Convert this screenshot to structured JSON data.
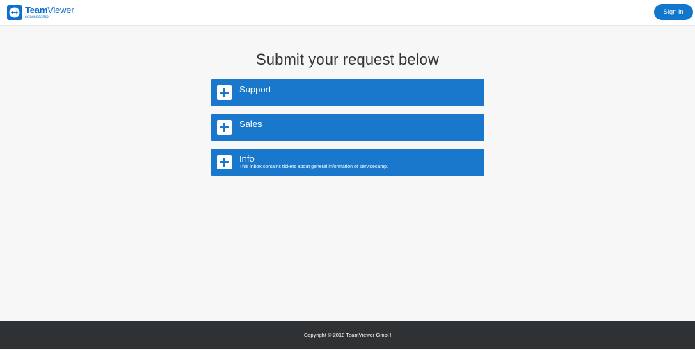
{
  "header": {
    "logo": {
      "brand_bold": "Team",
      "brand_light": "Viewer",
      "subtitle": "servicecamp",
      "icon": "teamviewer-logo-icon"
    },
    "sign_in_label": "Sign in"
  },
  "main": {
    "title": "Submit your request below",
    "inboxes": [
      {
        "name": "Support",
        "description": "",
        "icon": "plus-icon"
      },
      {
        "name": "Sales",
        "description": "",
        "icon": "plus-icon"
      },
      {
        "name": "Info",
        "description": "This inbox contains tickets about general information of servicecamp.",
        "icon": "plus-icon"
      }
    ]
  },
  "footer": {
    "copyright": "Copyright © 2018 TeamViewer GmbH"
  },
  "colors": {
    "accent": "#1a78cc",
    "brand": "#0e6fd0",
    "background": "#f7f7f7",
    "footer": "#2f3235"
  }
}
